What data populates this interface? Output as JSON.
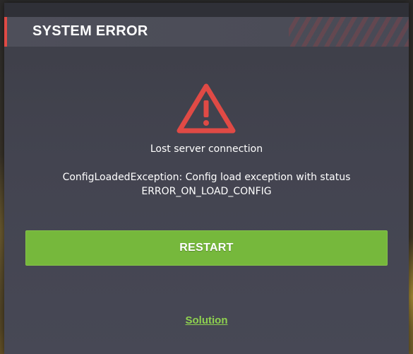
{
  "dialog": {
    "title": "SYSTEM ERROR",
    "icon": "warning-triangle-icon",
    "message": "Lost server connection",
    "detail_line1": "ConfigLoadedException: Config load exception with status",
    "detail_line2": "ERROR_ON_LOAD_CONFIG",
    "restart_label": "RESTART",
    "solution_label": "Solution"
  },
  "colors": {
    "accent_red": "#e04a45",
    "button_green": "#76b83c",
    "link_green": "#8fd24f",
    "panel_bg": "#434450"
  }
}
